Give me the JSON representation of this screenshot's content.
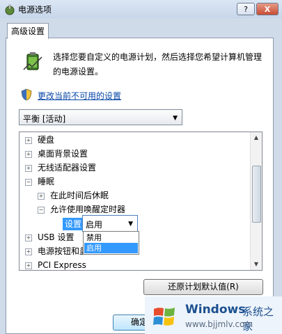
{
  "window": {
    "title": "电源选项",
    "help_label": "?",
    "close_label": "X"
  },
  "tab": {
    "label": "高级设置"
  },
  "description": "选择您要自定义的电源计划，然后选择您希望计算机管理的电源设置。",
  "link": {
    "label": "更改当前不可用的设置"
  },
  "plan_select": {
    "value": "平衡 [活动]"
  },
  "tree": {
    "items": [
      {
        "expander": "+",
        "label": "硬盘"
      },
      {
        "expander": "+",
        "label": "桌面背景设置"
      },
      {
        "expander": "+",
        "label": "无线适配器设置"
      },
      {
        "expander": "−",
        "label": "睡眠"
      },
      {
        "expander": "+",
        "label": "在此时间后休眠"
      },
      {
        "expander": "−",
        "label": "允许使用唤醒定时器"
      },
      {
        "expander": "+",
        "label": "USB 设置"
      },
      {
        "expander": "+",
        "label": "电源按钮和盖"
      },
      {
        "expander": "+",
        "label": "PCI Express"
      }
    ],
    "setting_label": "设置",
    "setting_value": "启用",
    "dropdown_options": [
      "禁用",
      "启用"
    ],
    "dropdown_selected_index": 1
  },
  "buttons": {
    "restore_label": "还原计划默认值(R)",
    "ok_label": "确定"
  },
  "watermark": {
    "name": "Windows",
    "name2": "系统之家",
    "url": "www.bjjmlv.com"
  },
  "colors": {
    "selection": "#3399ff",
    "link": "#0645a6",
    "titlebar": "#c7d6ea"
  }
}
